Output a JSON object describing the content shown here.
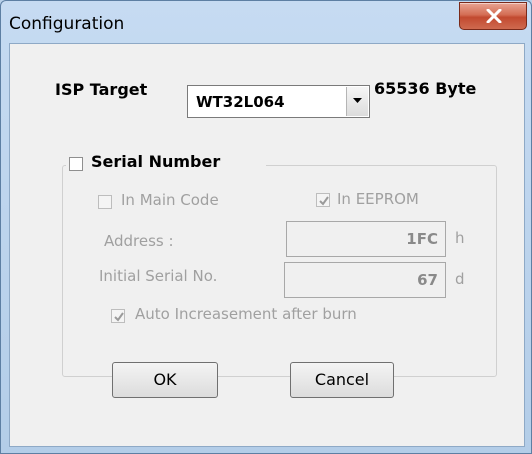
{
  "window": {
    "title": "Configuration"
  },
  "isp": {
    "label": "ISP Target",
    "selected": "WT32L064",
    "size": "65536 Byte"
  },
  "serial": {
    "label": "Serial Number",
    "checked": false,
    "main_code": {
      "label": "In Main Code",
      "checked": false
    },
    "eeprom": {
      "label": "In EEPROM",
      "checked": true
    },
    "address": {
      "label": "Address :",
      "value": "1FC",
      "unit": "h"
    },
    "initial": {
      "label": "Initial Serial No.",
      "value": "67",
      "unit": "d"
    },
    "auto": {
      "label": "Auto Increasement after burn",
      "checked": true
    }
  },
  "buttons": {
    "ok": "OK",
    "cancel": "Cancel"
  }
}
